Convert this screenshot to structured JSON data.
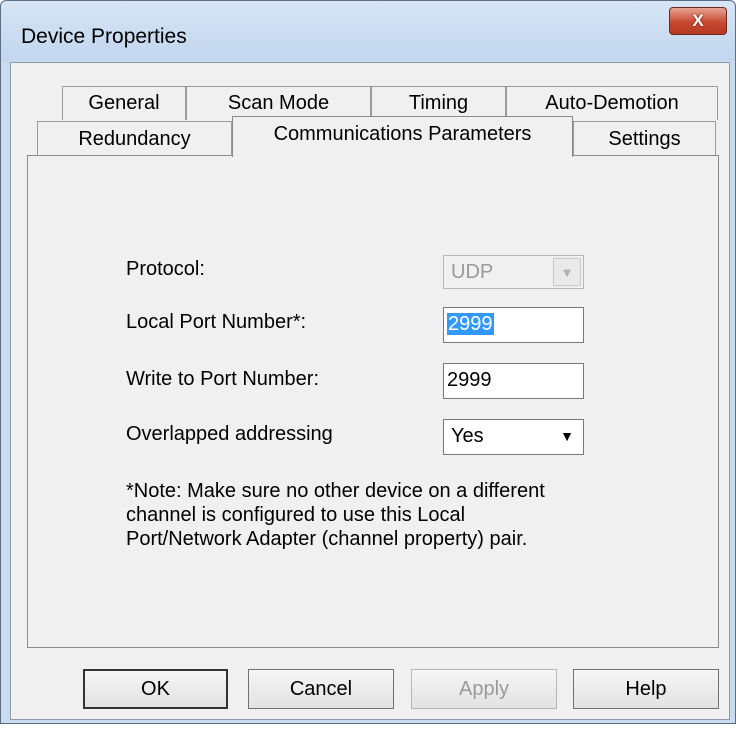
{
  "window": {
    "title": "Device Properties",
    "close_glyph": "X"
  },
  "tabs": {
    "row1": [
      "General",
      "Scan Mode",
      "Timing",
      "Auto-Demotion"
    ],
    "row2": [
      "Redundancy",
      "Communications Parameters",
      "Settings"
    ],
    "active": "Communications Parameters"
  },
  "form": {
    "protocol_label": "Protocol:",
    "protocol_value": "UDP",
    "local_port_label": "Local Port Number*:",
    "local_port_value": "2999",
    "write_port_label": "Write to Port Number:",
    "write_port_value": "2999",
    "overlapped_label": "Overlapped addressing",
    "overlapped_value": "Yes"
  },
  "note": {
    "line1": "*Note: Make sure no other device on a different",
    "line2": "channel is configured to use this Local",
    "line3": "Port/Network Adapter (channel property) pair."
  },
  "buttons": {
    "ok": "OK",
    "cancel": "Cancel",
    "apply": "Apply",
    "help": "Help"
  },
  "icons": {
    "dropdown": "chevron-down-icon",
    "close": "close-icon"
  }
}
